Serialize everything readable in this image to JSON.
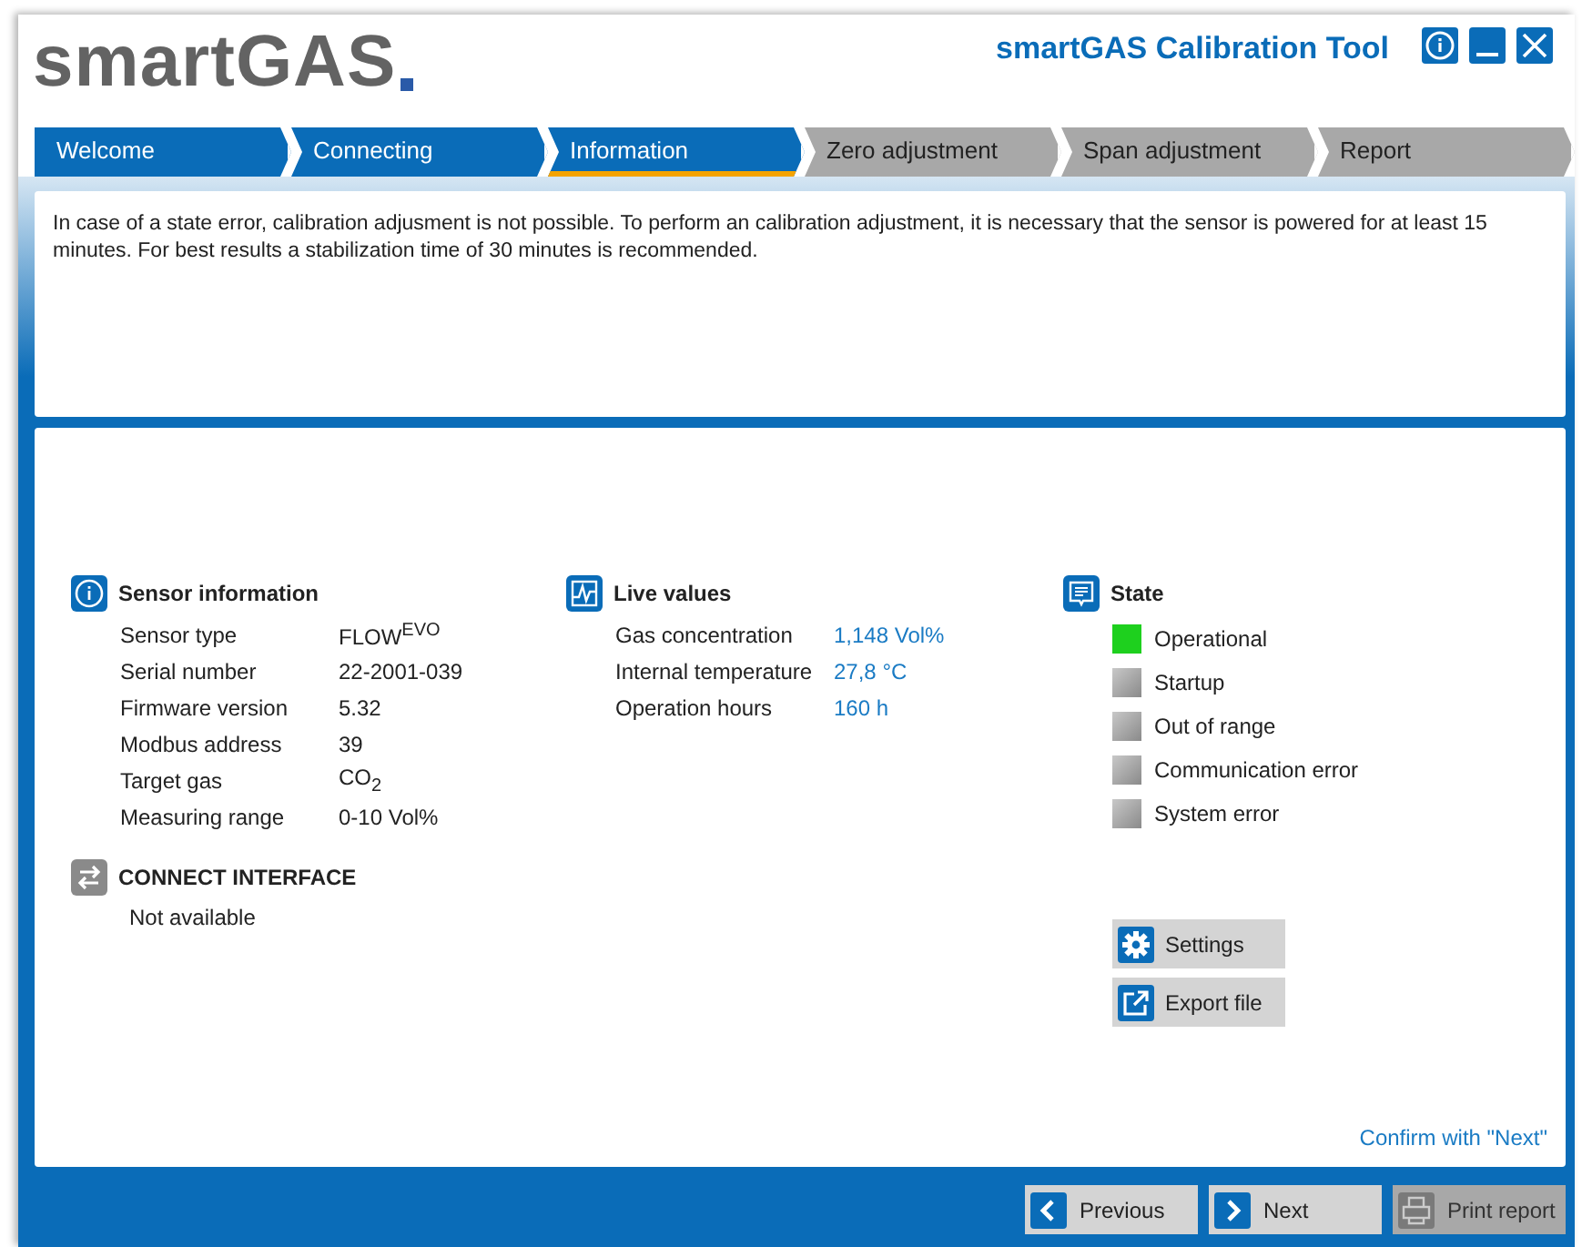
{
  "header": {
    "logo": "smartGAS",
    "title": "smartGAS Calibration Tool"
  },
  "tabs": [
    {
      "label": "Welcome",
      "completed": true,
      "selected": false
    },
    {
      "label": "Connecting",
      "completed": true,
      "selected": false
    },
    {
      "label": "Information",
      "completed": true,
      "selected": true
    },
    {
      "label": "Zero adjustment",
      "completed": false,
      "selected": false
    },
    {
      "label": "Span adjustment",
      "completed": false,
      "selected": false
    },
    {
      "label": "Report",
      "completed": false,
      "selected": false
    }
  ],
  "notice": "In case of a state error, calibration adjusment is not possible. To perform an calibration adjustment, it is necessary that the sensor is powered for at least 15 minutes. For best results a stabilization time of 30 minutes is recommended.",
  "sensor_information": {
    "title": "Sensor information",
    "rows": [
      {
        "label": "Sensor type",
        "value": "FLOW$^{EVO}$"
      },
      {
        "label": "Serial number",
        "value": "22-2001-039"
      },
      {
        "label": "Firmware version",
        "value": "5.32"
      },
      {
        "label": "Modbus address",
        "value": "39"
      },
      {
        "label": "Target gas",
        "value": "CO$_{2}$"
      },
      {
        "label": "Measuring range",
        "value": "0-10 Vol%"
      }
    ]
  },
  "connect_interface": {
    "title": "CONNECT INTERFACE",
    "value": "Not available"
  },
  "live_values": {
    "title": "Live values",
    "rows": [
      {
        "label": "Gas concentration",
        "value": "1,148 Vol%"
      },
      {
        "label": "Internal temperature",
        "value": "27,8 °C"
      },
      {
        "label": "Operation hours",
        "value": "160 h"
      }
    ]
  },
  "state": {
    "title": "State",
    "items": [
      {
        "label": "Operational",
        "on": true
      },
      {
        "label": "Startup",
        "on": false
      },
      {
        "label": "Out of range",
        "on": false
      },
      {
        "label": "Communication error",
        "on": false
      },
      {
        "label": "System error",
        "on": false
      }
    ]
  },
  "actions": [
    {
      "kind": "settings",
      "label": "Settings"
    },
    {
      "kind": "export",
      "label": "Export file"
    }
  ],
  "hint": "Confirm with \"Next\"",
  "footer_buttons": [
    {
      "kind": "previous",
      "label": "Previous",
      "disabled": false
    },
    {
      "kind": "next",
      "label": "Next",
      "disabled": false
    },
    {
      "kind": "print",
      "label": "Print report",
      "disabled": true
    }
  ]
}
